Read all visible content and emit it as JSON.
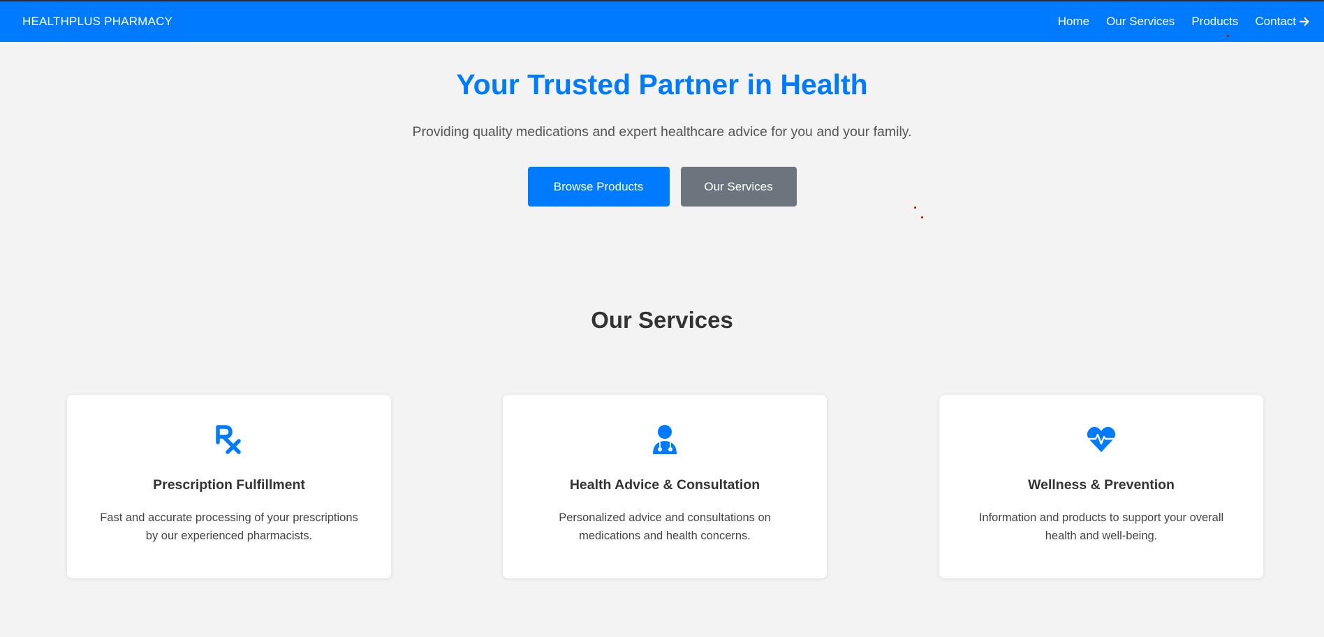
{
  "navbar": {
    "brand": "HEALTHPLUS PHARMACY",
    "links": [
      {
        "label": "Home"
      },
      {
        "label": "Our Services"
      },
      {
        "label": "Products"
      },
      {
        "label": "Contact"
      }
    ],
    "background_color": "#007bff",
    "contact_icon": "arrow-right-icon"
  },
  "hero": {
    "title": "Your Trusted Partner in Health",
    "subtitle": "Providing quality medications and expert healthcare advice for you and your family.",
    "primary_button": "Browse Products",
    "secondary_button": "Our Services",
    "title_color": "#007bff",
    "secondary_color": "#6c757d"
  },
  "services": {
    "title": "Our Services",
    "cards": [
      {
        "icon": "prescription-rx-icon",
        "title": "Prescription Fulfillment",
        "text": "Fast and accurate processing of your prescriptions by our experienced pharmacists."
      },
      {
        "icon": "doctor-icon",
        "title": "Health Advice & Consultation",
        "text": "Personalized advice and consultations on medications and health concerns."
      },
      {
        "icon": "heart-pulse-icon",
        "title": "Wellness & Prevention",
        "text": "Information and products to support your overall health and well-being."
      }
    ]
  }
}
